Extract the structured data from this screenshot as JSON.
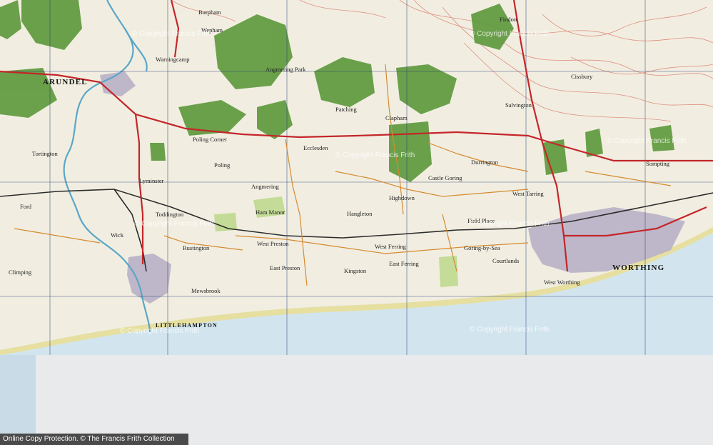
{
  "map": {
    "labels": {
      "arundel": "ARUNDEL",
      "worthing": "WORTHING",
      "littlehampton": "LITTLEHAMPTON",
      "burpham": "Burpham",
      "wepham": "Wepham",
      "warningcamp": "Warningcamp",
      "angmering_park": "Angmering Park",
      "patching": "Patching",
      "clapham": "Clapham",
      "findon": "Findon",
      "poling": "Poling",
      "poling_corner": "Poling Corner",
      "lyminster": "Lyminster",
      "angmering": "Angmering",
      "ham_manor": "Ham Manor",
      "toddington": "Toddington",
      "wick": "Wick",
      "ford": "Ford",
      "climping": "Climping",
      "rustington": "Rustington",
      "west_preston": "West Preston",
      "east_preston": "East Preston",
      "kingston": "Kingston",
      "west_ferring": "West Ferring",
      "east_ferring": "East Ferring",
      "goring_by_sea": "Goring-by-Sea",
      "durrington": "Durrington",
      "west_tarring": "West Tarring",
      "sompting": "Sompting",
      "highdown": "Highdown",
      "hangleton": "Hangleton",
      "courtlands": "Courtlands",
      "west_worthing": "West Worthing",
      "mewsbrook": "Mewsbrook",
      "tortington": "Tortington",
      "field_place": "Field Place",
      "salvington": "Salvington",
      "castle_goring": "Castle Goring",
      "ecclesden": "Ecclesden",
      "cissbury": "Cissbury"
    },
    "watermarks": {
      "wm1": "© Copyright Francis Frith",
      "wm2": "© Copyright Francis Frith",
      "wm3": "© Copyright Francis Frith",
      "wm4": "© Copyright Francis Frith",
      "wm5": "© Copyright Francis Frith",
      "wm6": "© Copyright Francis Frith",
      "wm7": "© Copyright Francis Frith",
      "wm8": "© Copyright Francis Frith"
    },
    "colors": {
      "land": "#f1eee1",
      "woodland": "#5f9a3e",
      "sea": "#d2e5ef",
      "beach": "#e6dfa0",
      "a_road": "#c4262a",
      "b_road": "#d58a32",
      "contour": "#d97060",
      "railway": "#2c2c2c",
      "grid": "#2b3f7a",
      "town": "#b8b0c6",
      "river": "#5aa6c9"
    }
  },
  "footer": {
    "text": "Online Copy Protection. © The Francis Frith Collection"
  }
}
